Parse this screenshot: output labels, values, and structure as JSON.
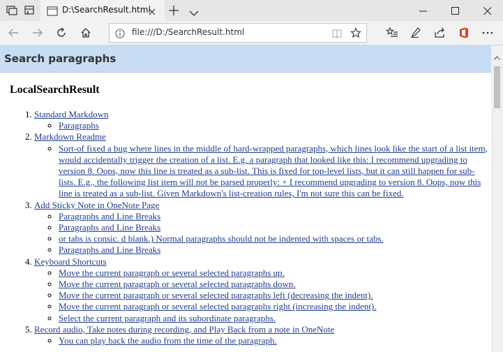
{
  "browser": {
    "tab_title": "D:\\SearchResult.html",
    "url": "file:///D:/SearchResult.html"
  },
  "page": {
    "banner_title": "Search paragraphs",
    "heading": "LocalSearchResult",
    "results": [
      {
        "title": "Standard Markdown",
        "items": [
          "Paragraphs"
        ]
      },
      {
        "title": "Markdown Readme",
        "items": [
          "Sort-of fixed a bug where lines in the middle of hard-wrapped paragraphs, which lines look like the start of a list item, would accidentally trigger the creation of a list. E.g. a paragraph that looked like this: I recommend upgrading to version 8. Oops, now this line is treated as a sub-list. This is fixed for top-level lists, but it can still happen for sub-lists. E.g., the following list item will not be parsed properly: + I recommend upgrading to version 8. Oops, now this line is treated as a sub-list. Given Markdown's list-creation rules, I'm not sure this can be fixed."
        ]
      },
      {
        "title": "Add Sticky Note in OneNote Page",
        "items": [
          "Paragraphs and Line Breaks",
          "Paragraphs and Line Breaks",
          "or tabs is consic. d blank.) Normal paragraphs should not be indented with spaces or tabs.",
          "Paragraphs and Line Breaks"
        ]
      },
      {
        "title": "Keyboard Shortcuts",
        "items": [
          "Move the current paragraph or several selected paragraphs up.",
          "Move the current paragraph or several selected paragraphs down.",
          "Move the current paragraph or several selected paragraphs left (decreasing the indent).",
          "Move the current paragraph or several selected paragraphs right (increasing the indent).",
          "Select the current paragraph and its subordinate paragraphs."
        ]
      },
      {
        "title": "Record audio, Take notes during recording, and Play Back from a note in OneNote",
        "items": [
          "You can play back the audio from the time of the paragraph."
        ]
      }
    ]
  },
  "colors": {
    "banner_bg": "#c7ddf3",
    "link": "#1f3d8c",
    "tabstrip_bg": "#e6e6e6",
    "office_icon": "#e3411f"
  }
}
